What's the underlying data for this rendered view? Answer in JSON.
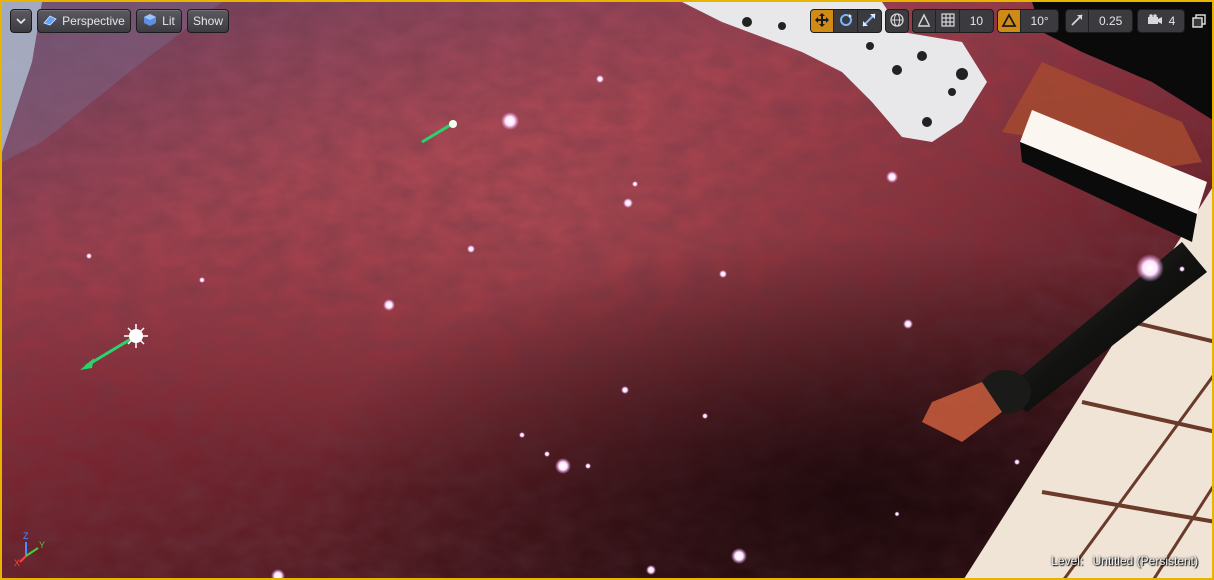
{
  "toolbar": {
    "menu_icon": "chevron-down-icon",
    "perspective_label": "Perspective",
    "view_mode_label": "Lit",
    "show_label": "Show",
    "grid_snap_value": "10",
    "rotation_snap_value": "10°",
    "scale_snap_value": "0.25",
    "camera_speed_value": "4",
    "accent_color": "#e8b400"
  },
  "status": {
    "level_prefix": "Level:",
    "level_name": "Untitled (Persistent)"
  },
  "axis": {
    "x": "X",
    "y": "Y",
    "z": "Z"
  }
}
